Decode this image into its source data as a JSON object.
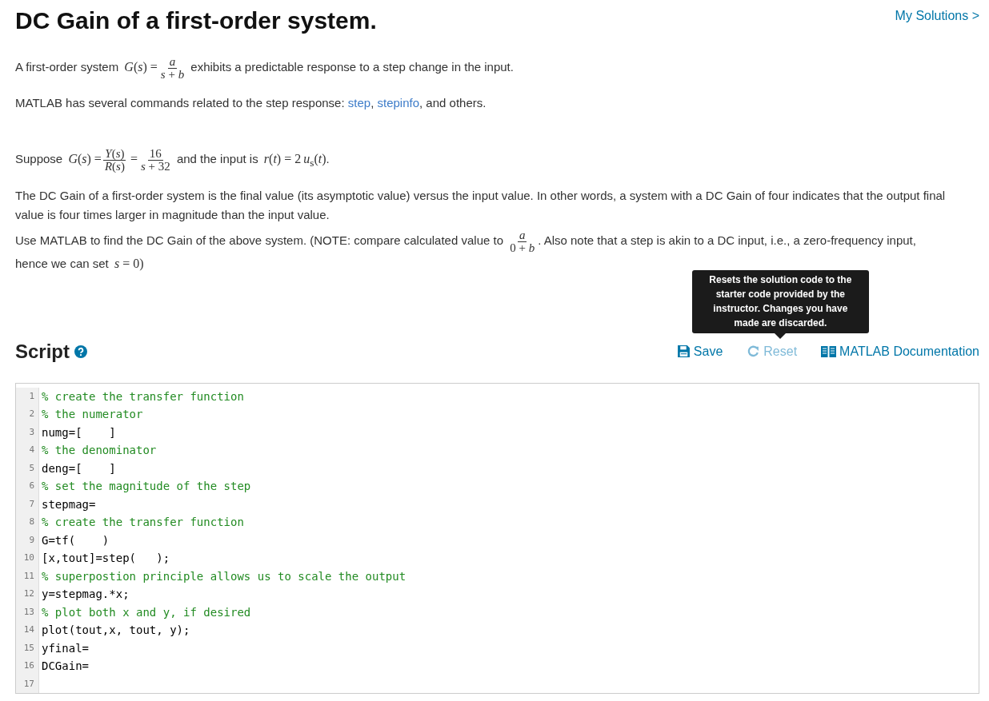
{
  "title": "DC Gain of a first-order system.",
  "my_solutions": "My Solutions >",
  "paragraphs": [
    [
      {
        "kind": "text",
        "text": "A first-order system "
      },
      {
        "kind": "math",
        "text": "*G*(*s*) ="
      },
      {
        "kind": "frac",
        "num": "*a*",
        "den": "*s* + *b*"
      },
      {
        "kind": "text",
        "text": " exhibits a predictable response to a step change in the input."
      }
    ],
    [
      {
        "kind": "text",
        "text": "MATLAB has several commands related to the step response: "
      },
      {
        "kind": "link",
        "text": "step"
      },
      {
        "kind": "text",
        "text": ", "
      },
      {
        "kind": "link",
        "text": "stepinfo"
      },
      {
        "kind": "text",
        "text": ", and others."
      }
    ],
    [
      {
        "kind": "text",
        "text": "Suppose "
      },
      {
        "kind": "math",
        "text": "*G*(*s*) ="
      },
      {
        "kind": "frac",
        "num": "*Y*(*s*)",
        "den": "*R*(*s*)"
      },
      {
        "kind": "math",
        "text": "="
      },
      {
        "kind": "frac",
        "num": "16",
        "den": "*s* + 32"
      },
      {
        "kind": "text",
        "text": " and the input is "
      },
      {
        "kind": "math",
        "text": "*r*(*t*) = 2"
      },
      {
        "kind": "math",
        "text": "*u*$_{s}$(*t*)"
      },
      {
        "kind": "text",
        "text": "."
      }
    ],
    [
      {
        "kind": "text",
        "text": "The DC Gain of a first-order system is the final value (its asymptotic value) versus the input value. In other words, a system with a DC Gain of four indicates that the output final value is four times larger in magnitude than the input value."
      }
    ],
    [
      {
        "kind": "text",
        "text": "Use MATLAB to find the DC Gain of the above system. (NOTE: compare calculated value to "
      },
      {
        "kind": "frac",
        "num": "*a*",
        "den": "0 + *b*"
      },
      {
        "kind": "text",
        "text": ". Also note that a step is akin to a DC input, i.e., a zero-frequency input, hence we can set "
      },
      {
        "kind": "math",
        "text": "*s* = 0)"
      }
    ]
  ],
  "script": {
    "heading": "Script",
    "save": "Save",
    "reset": "Reset",
    "documentation": "MATLAB Documentation",
    "tooltip": "Resets the solution code to the starter code provided by the instructor. Changes you have made are discarded.",
    "lines": [
      {
        "number": "1",
        "kind": "comment",
        "text": "% create the transfer function"
      },
      {
        "number": "2",
        "kind": "comment",
        "text": "% the numerator"
      },
      {
        "number": "3",
        "kind": "code",
        "text": "numg=[    ]"
      },
      {
        "number": "4",
        "kind": "comment",
        "text": "% the denominator"
      },
      {
        "number": "5",
        "kind": "code",
        "text": "deng=[    ]"
      },
      {
        "number": "6",
        "kind": "comment",
        "text": "% set the magnitude of the step"
      },
      {
        "number": "7",
        "kind": "code",
        "text": "stepmag="
      },
      {
        "number": "8",
        "kind": "comment",
        "text": "% create the transfer function"
      },
      {
        "number": "9",
        "kind": "code",
        "text": "G=tf(    )"
      },
      {
        "number": "10",
        "kind": "code",
        "text": "[x,tout]=step(   );"
      },
      {
        "number": "11",
        "kind": "comment",
        "text": "% superpostion principle allows us to scale the output"
      },
      {
        "number": "12",
        "kind": "code",
        "text": "y=stepmag.*x;"
      },
      {
        "number": "13",
        "kind": "comment",
        "text": "% plot both x and y, if desired"
      },
      {
        "number": "14",
        "kind": "code",
        "text": "plot(tout,x, tout, y);"
      },
      {
        "number": "15",
        "kind": "code",
        "text": "yfinal="
      },
      {
        "number": "16",
        "kind": "code",
        "text": "DCGain="
      },
      {
        "number": "17"
      }
    ]
  }
}
